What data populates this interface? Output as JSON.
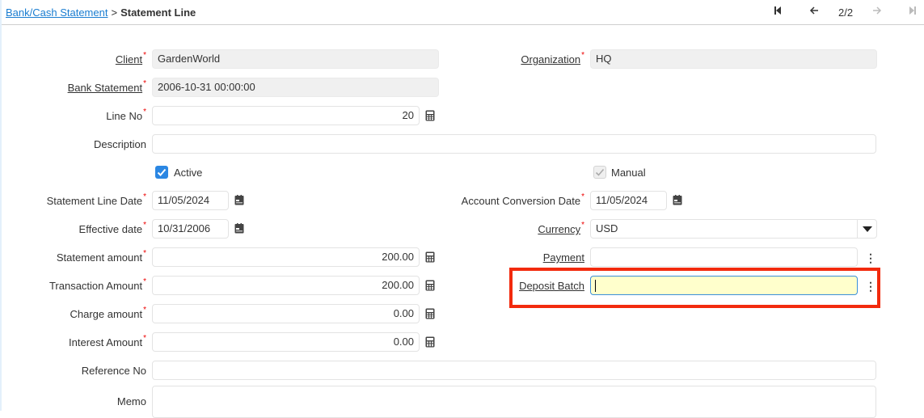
{
  "breadcrumb": {
    "parent": "Bank/Cash Statement",
    "separator": ">",
    "current": "Statement Line"
  },
  "navigation": {
    "first_icon": "first-record-icon",
    "prev_icon": "previous-record-icon",
    "record_count": "2/2",
    "next_icon": "next-record-icon",
    "last_icon": "last-record-icon"
  },
  "form": {
    "client": {
      "label": "Client",
      "value": "GardenWorld",
      "required": "*"
    },
    "organization": {
      "label": "Organization",
      "value": "HQ",
      "required": "*"
    },
    "bank_statement": {
      "label": "Bank Statement",
      "value": "2006-10-31 00:00:00",
      "required": "*"
    },
    "line_no": {
      "label": "Line No",
      "value": "20",
      "required": "*"
    },
    "description": {
      "label": "Description",
      "value": ""
    },
    "active": {
      "label": "Active",
      "checked": true
    },
    "manual": {
      "label": "Manual",
      "checked": true,
      "disabled": true
    },
    "statement_line_date": {
      "label": "Statement Line Date",
      "value": "11/05/2024",
      "required": "*"
    },
    "account_conversion_date": {
      "label": "Account Conversion Date",
      "value": "11/05/2024",
      "required": "*"
    },
    "effective_date": {
      "label": "Effective date",
      "value": "10/31/2006",
      "required": "*"
    },
    "currency": {
      "label": "Currency",
      "value": "USD",
      "required": "*"
    },
    "statement_amount": {
      "label": "Statement amount",
      "value": "200.00",
      "required": "*"
    },
    "payment": {
      "label": "Payment",
      "value": ""
    },
    "transaction_amount": {
      "label": "Transaction Amount",
      "value": "200.00",
      "required": "*"
    },
    "deposit_batch": {
      "label": "Deposit Batch",
      "value": ""
    },
    "charge_amount": {
      "label": "Charge amount",
      "value": "0.00",
      "required": "*"
    },
    "interest_amount": {
      "label": "Interest Amount",
      "value": "0.00",
      "required": "*"
    },
    "reference_no": {
      "label": "Reference No",
      "value": ""
    },
    "memo": {
      "label": "Memo",
      "value": ""
    }
  },
  "colors": {
    "link": "#1a7dd1",
    "required": "#ee0000",
    "focused_field_bg": "#ffffcc",
    "highlight_box": "#f22a0d",
    "checkbox_on": "#2b87e3"
  }
}
